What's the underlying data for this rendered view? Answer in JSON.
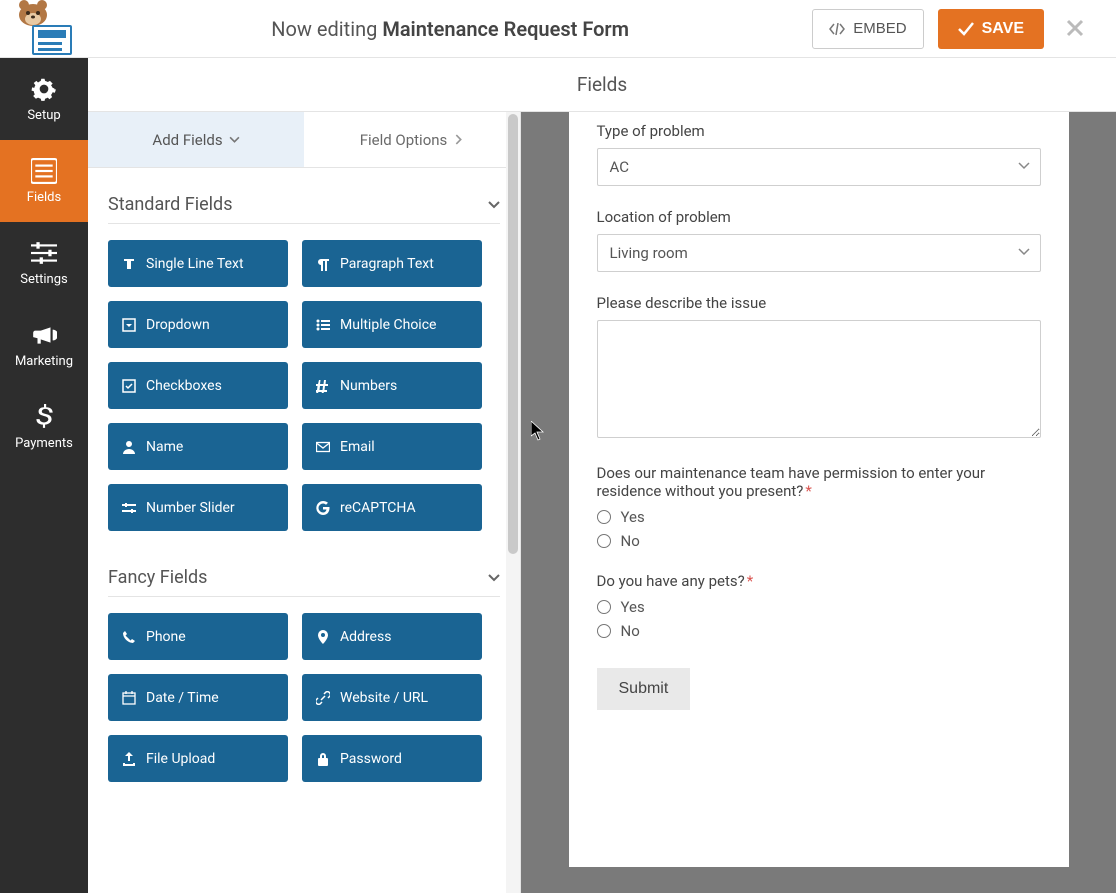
{
  "header": {
    "now_editing": "Now editing ",
    "form_name": "Maintenance Request Form",
    "embed": "EMBED",
    "save": "SAVE"
  },
  "sidenav": {
    "setup": "Setup",
    "fields": "Fields",
    "settings": "Settings",
    "marketing": "Marketing",
    "payments": "Payments"
  },
  "section_title": "Fields",
  "tabs": {
    "add": "Add Fields",
    "options": "Field Options"
  },
  "groups": {
    "standard": {
      "title": "Standard Fields",
      "items": [
        "Single Line Text",
        "Paragraph Text",
        "Dropdown",
        "Multiple Choice",
        "Checkboxes",
        "Numbers",
        "Name",
        "Email",
        "Number Slider",
        "reCAPTCHA"
      ]
    },
    "fancy": {
      "title": "Fancy Fields",
      "items": [
        "Phone",
        "Address",
        "Date / Time",
        "Website / URL",
        "File Upload",
        "Password"
      ]
    }
  },
  "preview": {
    "type_label": "Type of problem",
    "type_value": "AC",
    "location_label": "Location of problem",
    "location_value": "Living room",
    "describe_label": "Please describe the issue",
    "permission_label": "Does our maintenance team have permission to enter your residence without you present?",
    "pets_label": "Do you have any pets?",
    "yes": "Yes",
    "no": "No",
    "submit": "Submit"
  }
}
